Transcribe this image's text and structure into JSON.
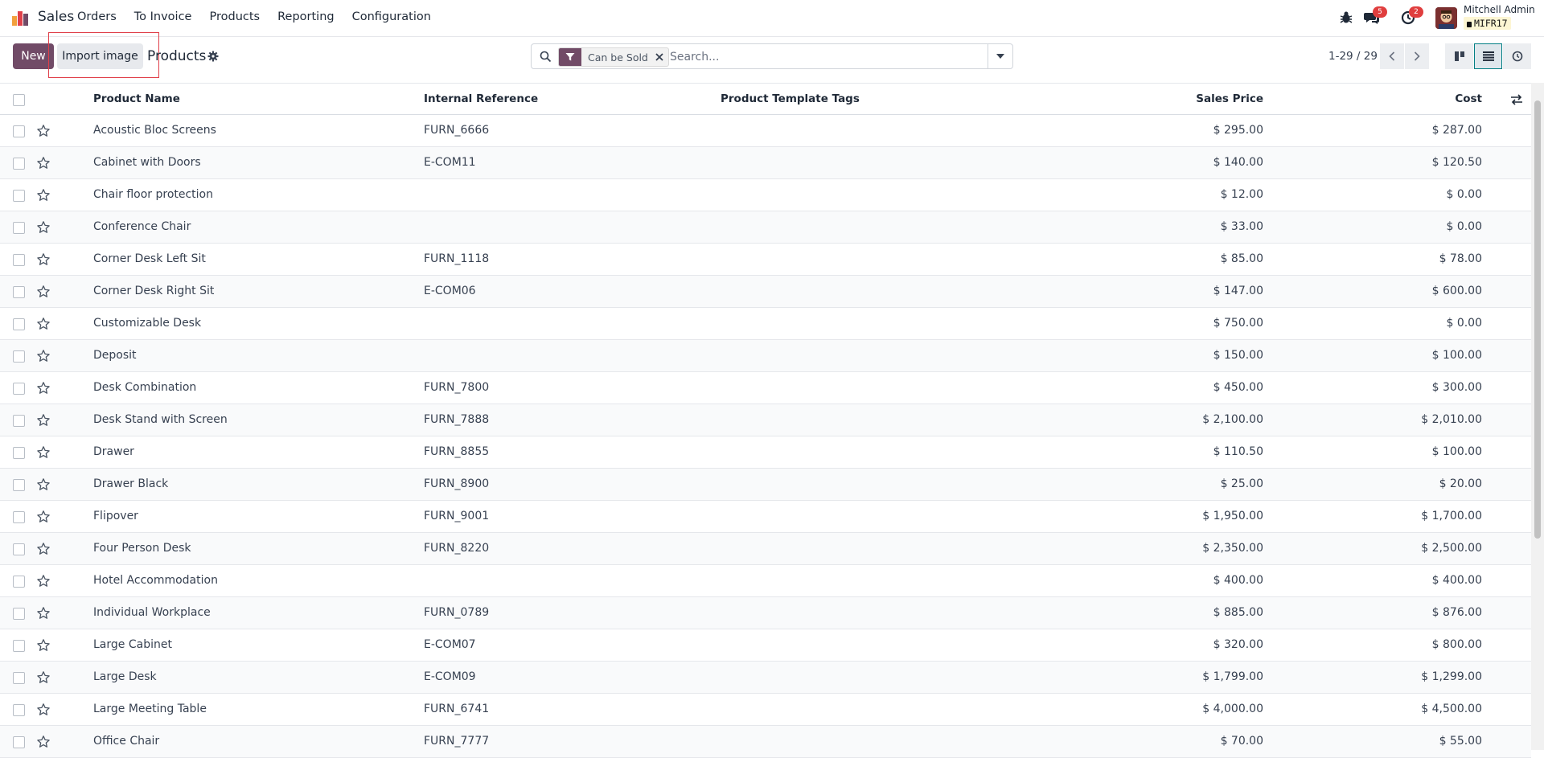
{
  "navbar": {
    "app_name": "Sales",
    "menu": [
      "Orders",
      "To Invoice",
      "Products",
      "Reporting",
      "Configuration"
    ],
    "messages_count": "5",
    "activities_count": "2",
    "user_name": "Mitchell Admin",
    "database": "MIFR17"
  },
  "control_panel": {
    "new_label": "New",
    "import_label": "Import image",
    "title": "Products",
    "facet_label": "Can be Sold",
    "search_placeholder": "Search...",
    "pager": "1-29 / 29"
  },
  "table": {
    "headers": {
      "name": "Product Name",
      "ref": "Internal Reference",
      "tags": "Product Template Tags",
      "price": "Sales Price",
      "cost": "Cost"
    },
    "rows": [
      {
        "name": "Acoustic Bloc Screens",
        "ref": "FURN_6666",
        "tags": "",
        "price": "$ 295.00",
        "cost": "$ 287.00"
      },
      {
        "name": "Cabinet with Doors",
        "ref": "E-COM11",
        "tags": "",
        "price": "$ 140.00",
        "cost": "$ 120.50"
      },
      {
        "name": "Chair floor protection",
        "ref": "",
        "tags": "",
        "price": "$ 12.00",
        "cost": "$ 0.00"
      },
      {
        "name": "Conference Chair",
        "ref": "",
        "tags": "",
        "price": "$ 33.00",
        "cost": "$ 0.00"
      },
      {
        "name": "Corner Desk Left Sit",
        "ref": "FURN_1118",
        "tags": "",
        "price": "$ 85.00",
        "cost": "$ 78.00"
      },
      {
        "name": "Corner Desk Right Sit",
        "ref": "E-COM06",
        "tags": "",
        "price": "$ 147.00",
        "cost": "$ 600.00"
      },
      {
        "name": "Customizable Desk",
        "ref": "",
        "tags": "",
        "price": "$ 750.00",
        "cost": "$ 0.00"
      },
      {
        "name": "Deposit",
        "ref": "",
        "tags": "",
        "price": "$ 150.00",
        "cost": "$ 100.00"
      },
      {
        "name": "Desk Combination",
        "ref": "FURN_7800",
        "tags": "",
        "price": "$ 450.00",
        "cost": "$ 300.00"
      },
      {
        "name": "Desk Stand with Screen",
        "ref": "FURN_7888",
        "tags": "",
        "price": "$ 2,100.00",
        "cost": "$ 2,010.00"
      },
      {
        "name": "Drawer",
        "ref": "FURN_8855",
        "tags": "",
        "price": "$ 110.50",
        "cost": "$ 100.00"
      },
      {
        "name": "Drawer Black",
        "ref": "FURN_8900",
        "tags": "",
        "price": "$ 25.00",
        "cost": "$ 20.00"
      },
      {
        "name": "Flipover",
        "ref": "FURN_9001",
        "tags": "",
        "price": "$ 1,950.00",
        "cost": "$ 1,700.00"
      },
      {
        "name": "Four Person Desk",
        "ref": "FURN_8220",
        "tags": "",
        "price": "$ 2,350.00",
        "cost": "$ 2,500.00"
      },
      {
        "name": "Hotel Accommodation",
        "ref": "",
        "tags": "",
        "price": "$ 400.00",
        "cost": "$ 400.00"
      },
      {
        "name": "Individual Workplace",
        "ref": "FURN_0789",
        "tags": "",
        "price": "$ 885.00",
        "cost": "$ 876.00"
      },
      {
        "name": "Large Cabinet",
        "ref": "E-COM07",
        "tags": "",
        "price": "$ 320.00",
        "cost": "$ 800.00"
      },
      {
        "name": "Large Desk",
        "ref": "E-COM09",
        "tags": "",
        "price": "$ 1,799.00",
        "cost": "$ 1,299.00"
      },
      {
        "name": "Large Meeting Table",
        "ref": "FURN_6741",
        "tags": "",
        "price": "$ 4,000.00",
        "cost": "$ 4,500.00"
      },
      {
        "name": "Office Chair",
        "ref": "FURN_7777",
        "tags": "",
        "price": "$ 70.00",
        "cost": "$ 55.00"
      }
    ]
  },
  "colors": {
    "brand": "#714b67",
    "active_view": "#017e84",
    "highlight": "#e0404a",
    "badge": "#e03e3e"
  },
  "icons": {
    "view_switcher": [
      "kanban-icon",
      "list-icon",
      "activity-icon"
    ]
  }
}
